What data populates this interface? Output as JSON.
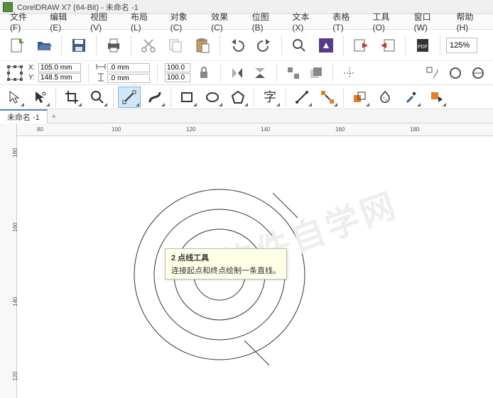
{
  "titlebar": {
    "title": "CorelDRAW X7 (64-Bit) - 未命名 -1"
  },
  "menu": {
    "file": "文件(F)",
    "edit": "编辑(E)",
    "view": "视图(V)",
    "layout": "布局(L)",
    "object": "对象(C)",
    "effects": "效果(C)",
    "bitmap": "位图(B)",
    "text": "文本(X)",
    "table": "表格(T)",
    "tools": "工具(O)",
    "window": "窗口(W)",
    "help": "帮助(H)"
  },
  "toolbar": {
    "zoom": "125%"
  },
  "prop": {
    "xlabel": "X:",
    "xval": "105.0 mm",
    "ylabel": "Y:",
    "yval": "148.5 mm",
    "wval": ".0 mm",
    "hval": ".0 mm",
    "perc1": "100.0",
    "perc2": "100.0"
  },
  "tab": {
    "name": "未命名 -1",
    "add": "+"
  },
  "tooltip": {
    "title": "2 点线工具",
    "desc": "连接起点和终点绘制一条直线。"
  },
  "hruler": {
    "ticks": [
      "80",
      "100",
      "120",
      "140",
      "160",
      "180"
    ]
  },
  "vruler": {
    "ticks": [
      "180",
      "160",
      "140",
      "120"
    ]
  },
  "watermark": "软件自学网"
}
